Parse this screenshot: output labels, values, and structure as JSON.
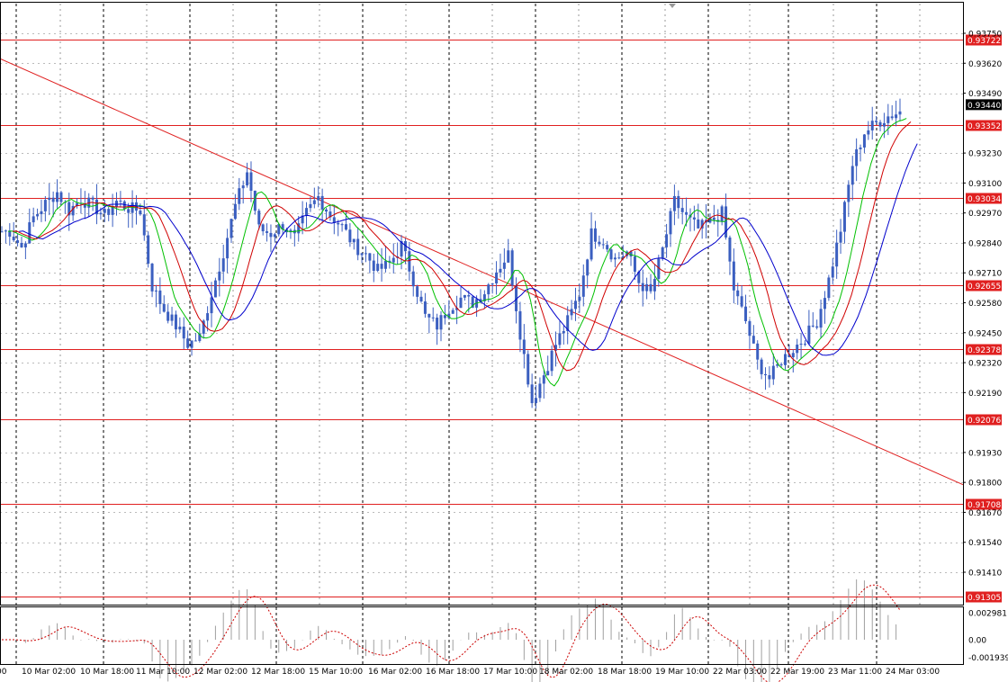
{
  "chart_data": {
    "type": "candlestick",
    "price_axis": {
      "ticks": [
        "0.93750",
        "0.93620",
        "0.93490",
        "0.93230",
        "0.93100",
        "0.92970",
        "0.92840",
        "0.92710",
        "0.92580",
        "0.92450",
        "0.92320",
        "0.92190",
        "0.91930",
        "0.91800",
        "0.91670",
        "0.91540",
        "0.91410"
      ],
      "min": 0.9128,
      "max": 0.9382
    },
    "indicator_axis": {
      "ticks": [
        "0.002981",
        "0.00",
        "-0.001939"
      ],
      "max": 0.002981,
      "min": -0.001939
    },
    "time_labels": [
      "00",
      "10 Mar 02:00",
      "10 Mar 18:00",
      "11 Mar 10:00",
      "12 Mar 02:00",
      "12 Mar 18:00",
      "15 Mar 10:00",
      "16 Mar 02:00",
      "16 Mar 18:00",
      "17 Mar 10:00",
      "18 Mar 02:00",
      "18 Mar 18:00",
      "19 Mar 10:00",
      "22 Mar 03:00",
      "22 Mar 19:00",
      "23 Mar 11:00",
      "24 Mar 03:00"
    ],
    "levels": [
      "0.93722",
      "0.93352",
      "0.93034",
      "0.92655",
      "0.92378",
      "0.92076",
      "0.91708",
      "0.91305"
    ],
    "current_price": "0.93440",
    "colors": {
      "candles": "#3b5fc0",
      "level": "#e02020",
      "level_label_bg": "#e02020",
      "current_label_bg": "#000000",
      "ma_green": "#00c000",
      "ma_red": "#d00000",
      "ma_blue": "#0000cc",
      "indicator_hist": "#a0a0a0",
      "indicator_signal": "#cc0000"
    },
    "trendline": {
      "from": 0.9364,
      "to": 0.9179
    },
    "closes": [
      0.9289,
      0.9282,
      0.9295,
      0.9301,
      0.9306,
      0.9298,
      0.9303,
      0.93,
      0.9296,
      0.9302,
      0.9299,
      0.9298,
      0.9265,
      0.9255,
      0.9248,
      0.924,
      0.9243,
      0.9262,
      0.928,
      0.93,
      0.9315,
      0.929,
      0.9288,
      0.9292,
      0.9286,
      0.9297,
      0.9304,
      0.9296,
      0.9291,
      0.9283,
      0.9279,
      0.9272,
      0.9275,
      0.9283,
      0.9268,
      0.9252,
      0.9248,
      0.9256,
      0.926,
      0.9258,
      0.9263,
      0.9272,
      0.9279,
      0.9245,
      0.9215,
      0.9227,
      0.924,
      0.925,
      0.9262,
      0.9288,
      0.9285,
      0.9277,
      0.928,
      0.9267,
      0.9262,
      0.9281,
      0.9302,
      0.9295,
      0.929,
      0.9293,
      0.9297,
      0.9264,
      0.925,
      0.9232,
      0.9225,
      0.9233,
      0.9238,
      0.9243,
      0.925,
      0.9268,
      0.929,
      0.9318,
      0.9332,
      0.9336,
      0.9339,
      0.9341
    ]
  }
}
